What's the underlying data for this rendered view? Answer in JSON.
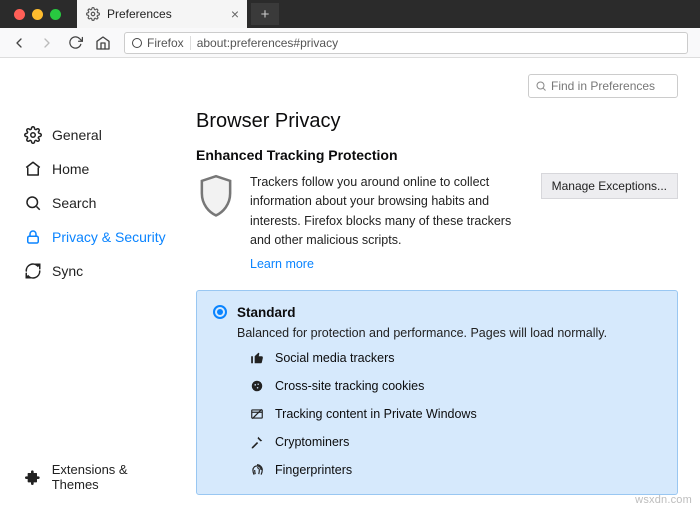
{
  "tab": {
    "title": "Preferences"
  },
  "urlbar": {
    "identity": "Firefox",
    "url": "about:preferences#privacy"
  },
  "findbox": {
    "placeholder": "Find in Preferences"
  },
  "sidebar": {
    "items": [
      {
        "label": "General"
      },
      {
        "label": "Home"
      },
      {
        "label": "Search"
      },
      {
        "label": "Privacy & Security"
      },
      {
        "label": "Sync"
      }
    ],
    "extensions_label": "Extensions & Themes"
  },
  "page": {
    "title": "Browser Privacy",
    "section_title": "Enhanced Tracking Protection",
    "etp_desc": "Trackers follow you around online to collect information about your browsing habits and interests. Firefox blocks many of these trackers and other malicious scripts.",
    "learn_more": "Learn more",
    "manage_exceptions": "Manage Exceptions...",
    "standard": {
      "title": "Standard",
      "desc": "Balanced for protection and performance. Pages will load normally.",
      "trackers": [
        "Social media trackers",
        "Cross-site tracking cookies",
        "Tracking content in Private Windows",
        "Cryptominers",
        "Fingerprinters"
      ]
    }
  },
  "watermark": "wsxdn.com"
}
